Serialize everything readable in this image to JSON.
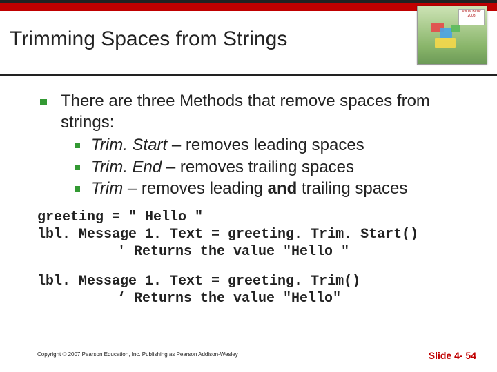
{
  "title": "Trimming Spaces from Strings",
  "main_point": "There are three Methods that remove spaces from strings:",
  "sub": [
    {
      "name": "Trim. Start",
      "desc": " – removes leading spaces"
    },
    {
      "name": "Trim. End",
      "desc": " – removes trailing spaces"
    },
    {
      "name": "Trim",
      "desc_a": " – removes leading ",
      "bold": "and",
      "desc_b": " trailing spaces"
    }
  ],
  "code1": {
    "l1": "greeting = \" Hello \"",
    "l2": "lbl. Message 1. Text = greeting. Trim. Start()",
    "l3": "' Returns the value \"Hello \""
  },
  "code2": {
    "l1": "lbl. Message 1. Text = greeting. Trim()",
    "l2": "‘ Returns the value \"Hello\""
  },
  "book_label": "Visual Basic 2008",
  "copyright": "Copyright © 2007 Pearson Education, Inc. Publishing as Pearson Addison-Wesley",
  "slide_label": "Slide 4- 54"
}
